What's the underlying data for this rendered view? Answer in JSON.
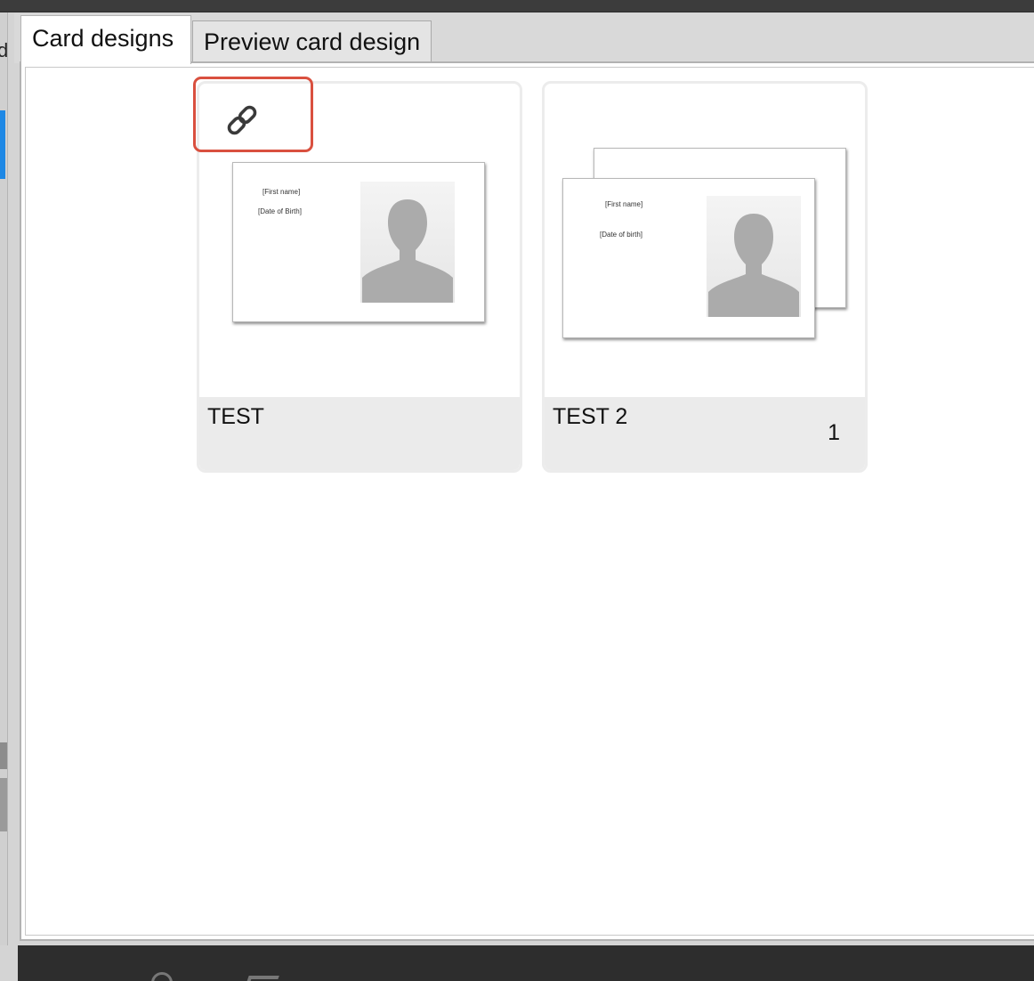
{
  "window": {
    "left_edge_letter": "d"
  },
  "tabs": [
    {
      "label": "Card designs",
      "active": true
    },
    {
      "label": "Preview card design",
      "active": false
    }
  ],
  "designs": [
    {
      "name": "TEST",
      "count": "",
      "linked": true,
      "icon": "link-icon",
      "sides": 1,
      "fields": [
        "[First name]",
        "[Date of Birth]"
      ]
    },
    {
      "name": "TEST 2",
      "count": "1",
      "linked": false,
      "sides": 2,
      "fields": [
        "[First name]",
        "[Date of birth]"
      ]
    }
  ],
  "colors": {
    "highlight_outline": "#d9503f",
    "selection_accent": "#1e88e5"
  }
}
